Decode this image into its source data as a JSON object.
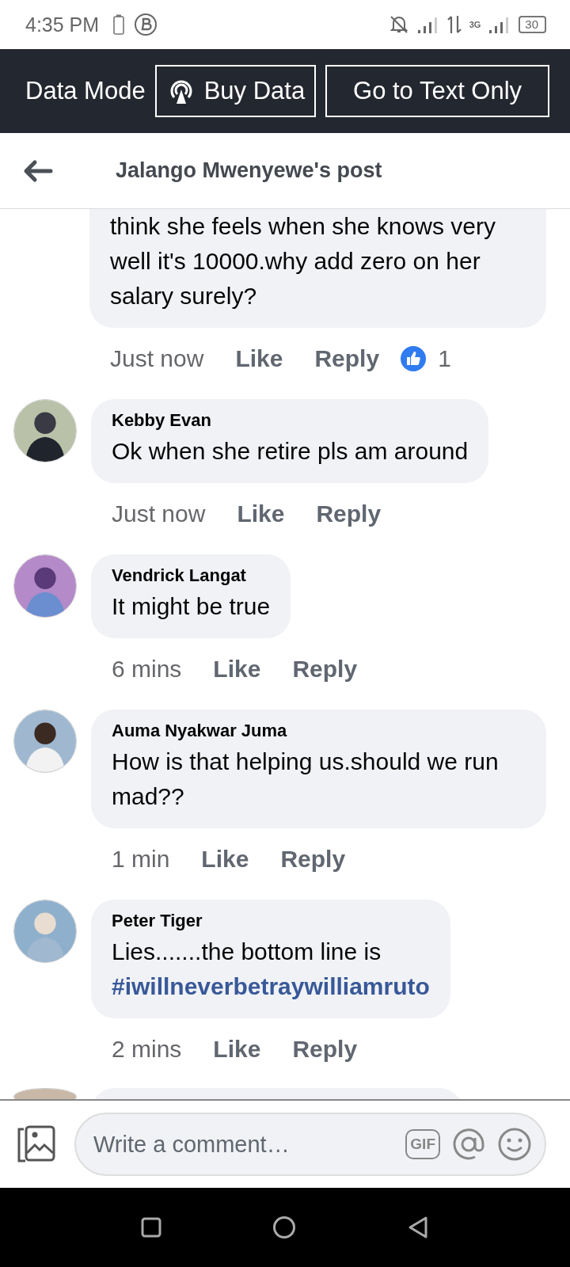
{
  "status_bar": {
    "time": "4:35 PM",
    "network": "3G",
    "battery": "30"
  },
  "data_bar": {
    "label": "Data Mode",
    "buttons": [
      {
        "label": "Buy Data",
        "kind": "buy"
      },
      {
        "label": "Go to Text Only",
        "kind": "plain"
      }
    ]
  },
  "header": {
    "title": "Jalango Mwenyewe's post"
  },
  "comments": [
    {
      "kind": "cut_top",
      "text": "think she feels when she knows very well it's 10000.why add zero on her salary surely?",
      "time": "Just now",
      "like": "Like",
      "reply": "Reply",
      "reactions": "1"
    },
    {
      "kind": "full",
      "author": "Kebby Evan",
      "text": "Ok when she retire pls am around",
      "time": "Just now",
      "like": "Like",
      "reply": "Reply"
    },
    {
      "kind": "full",
      "author": "Vendrick Langat",
      "text": "It might be true",
      "time": "6 mins",
      "like": "Like",
      "reply": "Reply"
    },
    {
      "kind": "full",
      "author": "Auma Nyakwar Juma",
      "text": "How is that helping us.should we run mad??",
      "time": "1 min",
      "like": "Like",
      "reply": "Reply"
    },
    {
      "kind": "full",
      "author": "Peter Tiger",
      "text": "Lies.......the bottom line is",
      "hashtag": "#iwillneverbetraywilliamruto",
      "time": "2 mins",
      "like": "Like",
      "reply": "Reply"
    },
    {
      "kind": "cut_bottom"
    }
  ],
  "composer": {
    "placeholder": "Write a comment…",
    "gif": "GIF"
  }
}
